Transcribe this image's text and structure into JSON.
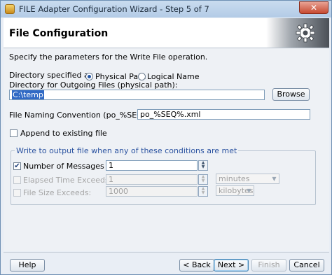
{
  "window": {
    "title": "FILE Adapter Configuration Wizard - Step 5 of 7",
    "close_label": "✕"
  },
  "header": {
    "title": "File Configuration",
    "graphic": "gear-icon"
  },
  "form": {
    "description": "Specify the parameters for the Write File operation.",
    "directory_specified_label": "Directory specified as",
    "physical_path_label": "Physical Path",
    "logical_name_label": "Logical Name",
    "directory_selected": "Physical Path",
    "outgoing_dir_label": "Directory for Outgoing Files (physical path):",
    "outgoing_dir_value": "C:\\temp",
    "browse_label": "Browse",
    "file_naming_label": "File Naming Convention (po_%SEQ%.txt):",
    "file_naming_value": "po_%SEQ%.xml",
    "append_label": "Append to existing file",
    "append_checked": false
  },
  "conditions": {
    "legend": "Write to output file when any of these conditions are met",
    "num_messages_label": "Number of Messages Equals:",
    "num_messages_checked": true,
    "num_messages_value": "1",
    "elapsed_label": "Elapsed Time Exceeds:",
    "elapsed_checked": false,
    "elapsed_value": "1",
    "elapsed_unit": "minutes",
    "file_size_label": "File Size Exceeds:",
    "file_size_checked": false,
    "file_size_value": "1000",
    "file_size_unit": "kilobytes"
  },
  "footer": {
    "help_label": "Help",
    "back_label": "< Back",
    "next_label": "Next >",
    "finish_label": "Finish",
    "cancel_label": "Cancel"
  }
}
